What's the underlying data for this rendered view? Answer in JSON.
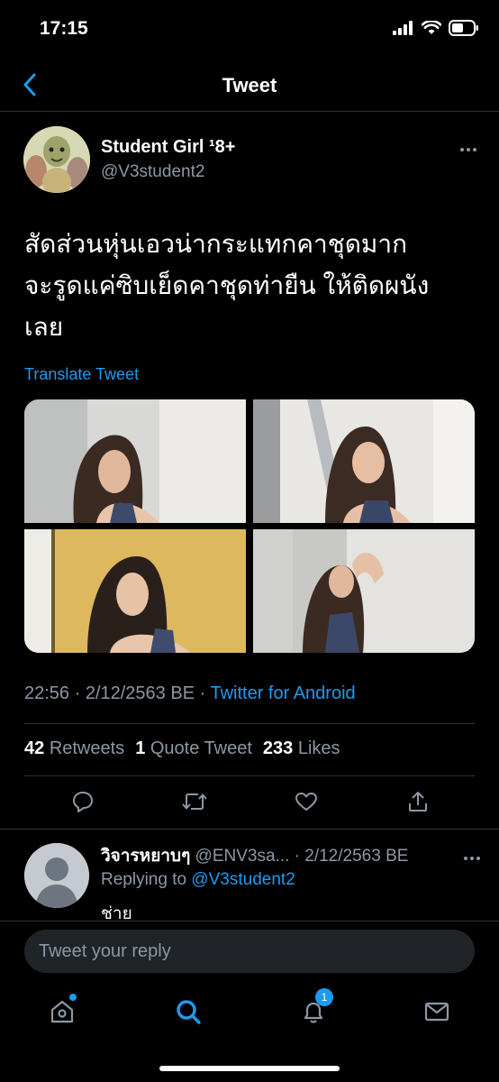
{
  "status": {
    "time": "17:15"
  },
  "nav": {
    "title": "Tweet"
  },
  "tweet": {
    "author_name": "Student Girl ¹8+",
    "handle": "@V3student2",
    "text_lines": [
      "สัดส่วนหุ่นเอวน่ากระแทกคาชุดมาก",
      "จะรูดแค่ซิบเย็ดคาชุดท่ายืน ให้ติดผนัง",
      "เลย"
    ],
    "translate": "Translate Tweet",
    "meta_time": "22:56 · 2/12/2563 BE · ",
    "source": "Twitter for Android",
    "retweets_count": "42",
    "retweets_label": "Retweets",
    "quotes_count": "1",
    "quotes_label": "Quote Tweet",
    "likes_count": "233",
    "likes_label": "Likes"
  },
  "reply": {
    "name": "วิจารหยาบๆ",
    "handle_date": " @ENV3sa... · 2/12/2563 BE",
    "replying_prefix": "Replying to ",
    "replying_to": "@V3student2",
    "text": "ช่าย"
  },
  "composer": {
    "placeholder": "Tweet your reply"
  },
  "tabbar": {
    "notifications_badge": "1"
  },
  "colors": {
    "accent": "#1d9bf0",
    "background": "#000000",
    "secondary_text": "#8b98a5"
  },
  "icons": [
    "back-icon",
    "more-icon",
    "reply-icon",
    "retweet-icon",
    "like-icon",
    "share-icon",
    "home-icon",
    "search-icon",
    "notifications-icon",
    "messages-icon"
  ]
}
